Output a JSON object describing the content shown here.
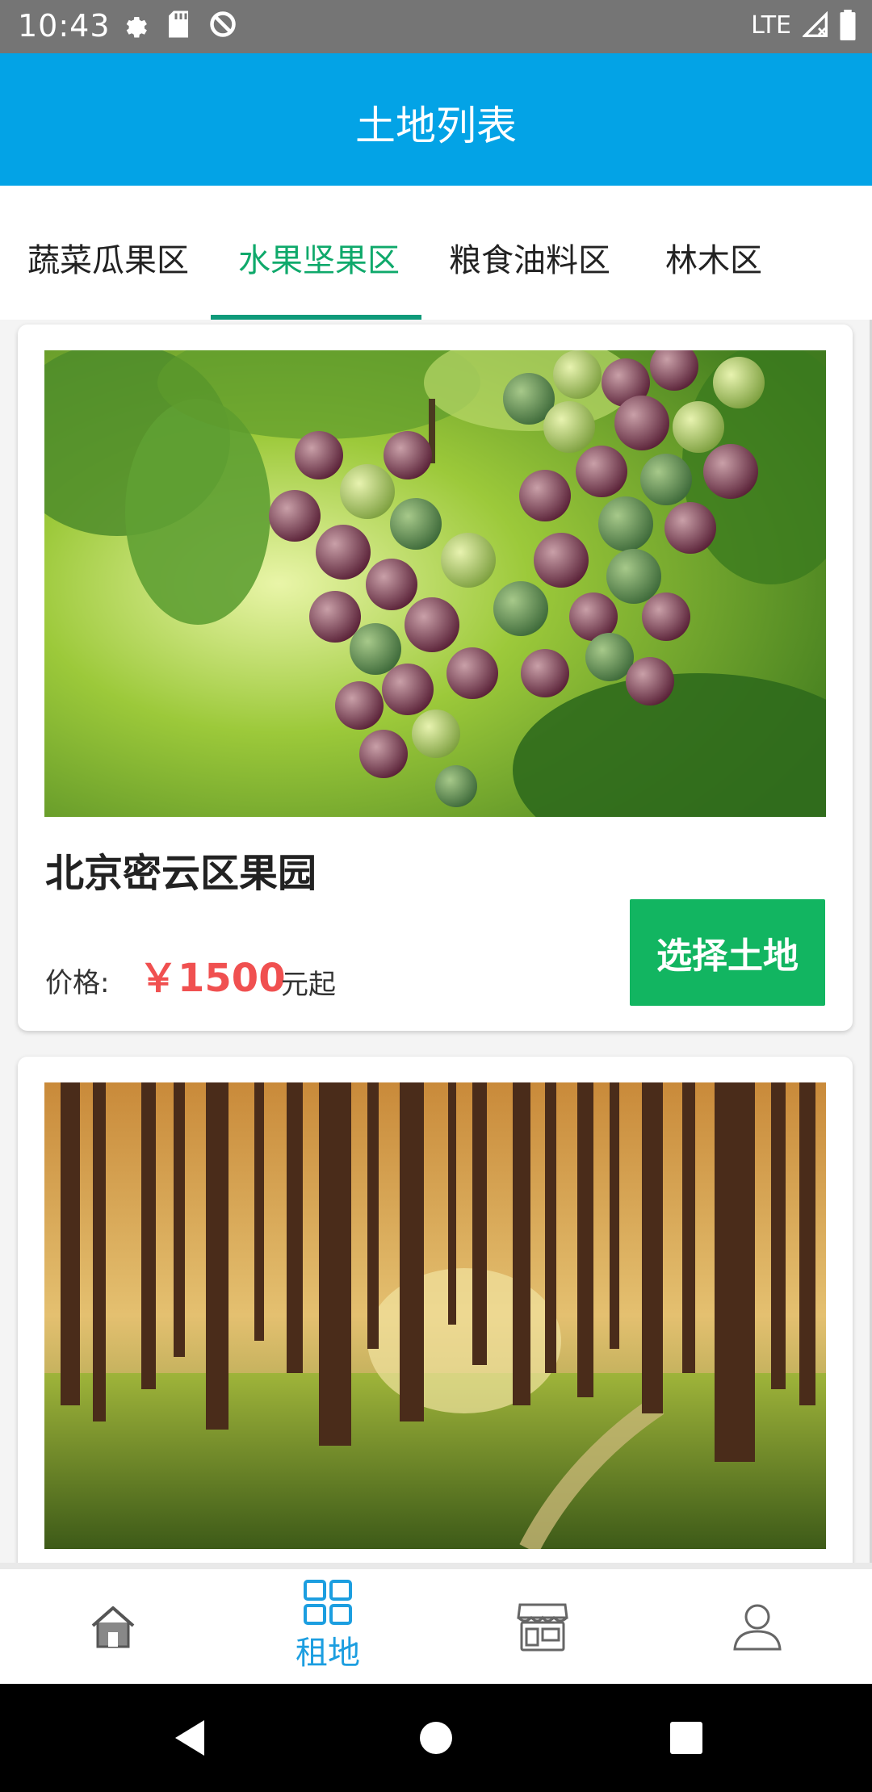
{
  "status_bar": {
    "time": "10:43",
    "network": "LTE",
    "left_icons": [
      "gear-icon",
      "sd-card-icon",
      "sync-disabled-icon"
    ],
    "right_icons": [
      "signal-icon",
      "battery-icon"
    ]
  },
  "app_bar": {
    "title": "土地列表"
  },
  "tabs": [
    {
      "label": "蔬菜瓜果区",
      "active": false
    },
    {
      "label": "水果坚果区",
      "active": true
    },
    {
      "label": "粮食油料区",
      "active": false
    },
    {
      "label": "林木区",
      "active": false
    }
  ],
  "cards": [
    {
      "image": "grapes-photo",
      "title": "北京密云区果园",
      "price_label": "价格:",
      "price_value": "￥1500",
      "price_suffix": "元起",
      "button_label": "选择土地"
    },
    {
      "image": "forest-photo"
    }
  ],
  "bottom_nav": [
    {
      "icon": "home-icon",
      "label": "",
      "active": false
    },
    {
      "icon": "grid-icon",
      "label": "租地",
      "active": true
    },
    {
      "icon": "store-icon",
      "label": "",
      "active": false
    },
    {
      "icon": "user-icon",
      "label": "",
      "active": false
    }
  ],
  "colors": {
    "app_bar": "#03a3e6",
    "tab_active": "#0fa96b",
    "price": "#f05050",
    "button": "#12b561",
    "nav_active": "#1c9ee0"
  }
}
